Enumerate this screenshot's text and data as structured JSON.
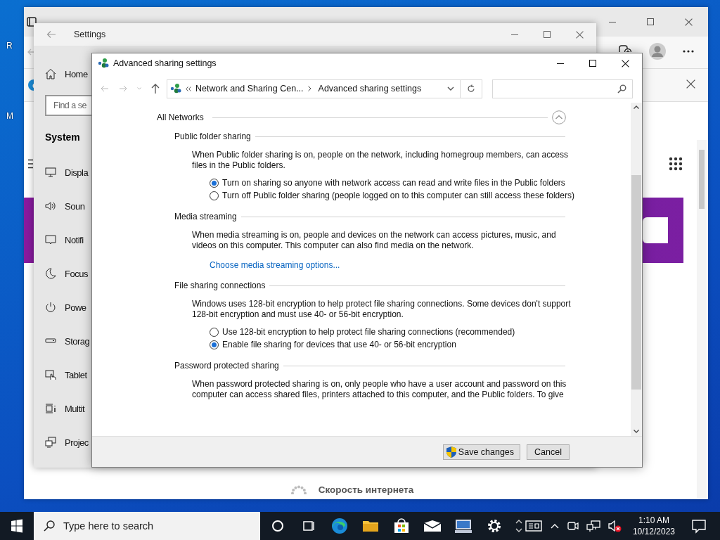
{
  "desktop": {
    "icon_labels": [
      "R",
      "M"
    ]
  },
  "browser": {
    "footer_text": "Скорость интернета"
  },
  "settings": {
    "title": "Settings",
    "home": "Home",
    "search": {
      "placeholder": "Find a se"
    },
    "section": "System",
    "items": [
      {
        "label": "Displa",
        "kind": "display"
      },
      {
        "label": "Soun",
        "kind": "sound"
      },
      {
        "label": "Notifi",
        "kind": "notifications"
      },
      {
        "label": "Focus",
        "kind": "focus"
      },
      {
        "label": "Powe",
        "kind": "power"
      },
      {
        "label": "Storag",
        "kind": "storage"
      },
      {
        "label": "Tablet",
        "kind": "tablet"
      },
      {
        "label": "Multit",
        "kind": "multitasking"
      },
      {
        "label": "Projec",
        "kind": "project"
      }
    ]
  },
  "dialog": {
    "title": "Advanced sharing settings",
    "breadcrumb": [
      "Network and Sharing Cen...",
      "Advanced sharing settings"
    ],
    "group": {
      "title": "All Networks",
      "expanded": true
    },
    "sections": [
      {
        "title": "Public folder sharing",
        "description": "When Public folder sharing is on, people on the network, including homegroup members, can access files in the Public folders.",
        "options": [
          {
            "label": "Turn on sharing so anyone with network access can read and write files in the Public folders",
            "selected": true
          },
          {
            "label": "Turn off Public folder sharing (people logged on to this computer can still access these folders)",
            "selected": false
          }
        ]
      },
      {
        "title": "Media streaming",
        "description": "When media streaming is on, people and devices on the network can access pictures, music, and videos on this computer. This computer can also find media on the network.",
        "link": "Choose media streaming options..."
      },
      {
        "title": "File sharing connections",
        "description": "Windows uses 128-bit encryption to help protect file sharing connections. Some devices don't support 128-bit encryption and must use 40- or 56-bit encryption.",
        "options": [
          {
            "label": "Use 128-bit encryption to help protect file sharing connections (recommended)",
            "selected": false
          },
          {
            "label": "Enable file sharing for devices that use 40- or 56-bit encryption",
            "selected": true
          }
        ]
      },
      {
        "title": "Password protected sharing",
        "description": "When password protected sharing is on, only people who have a user account and password on this computer can access shared files, printers attached to this computer, and the Public folders. To give"
      }
    ],
    "buttons": [
      {
        "label": "Save changes",
        "kind": "elevated"
      },
      {
        "label": "Cancel",
        "kind": "plain"
      }
    ]
  },
  "taskbar": {
    "search": {
      "placeholder": "Type here to search"
    },
    "time": "1:10 AM",
    "date": "10/12/2023"
  }
}
